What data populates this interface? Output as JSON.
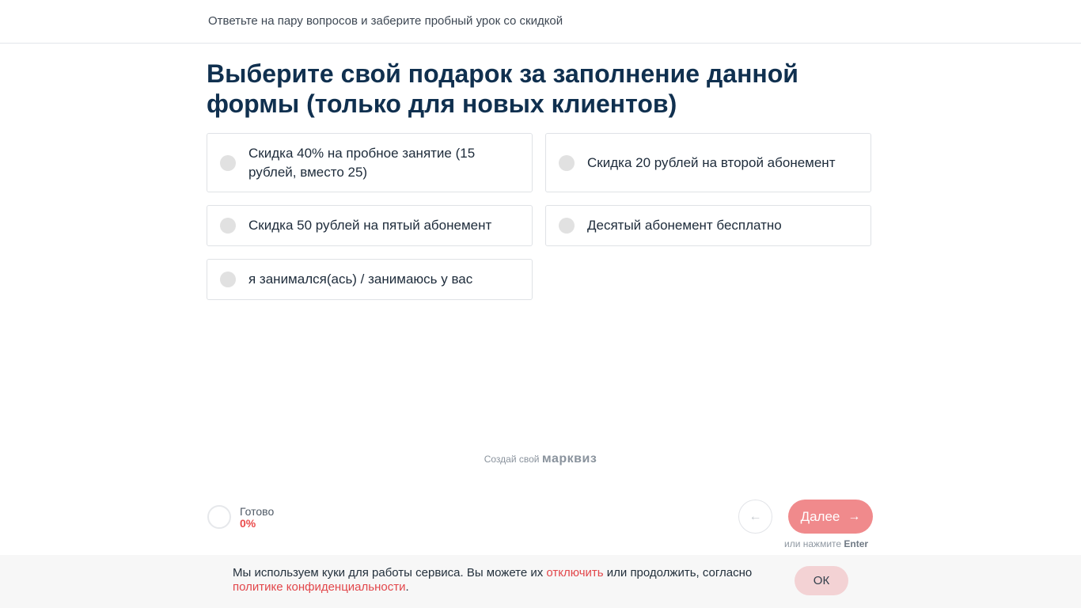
{
  "header": {
    "text": "Ответьте на пару вопросов и заберите пробный урок со скидкой"
  },
  "question": {
    "title": "Выберите свой подарок за заполнение данной формы (только для новых клиентов)"
  },
  "options": [
    {
      "label": "Скидка 40% на пробное занятие (15 рублей, вместо 25)"
    },
    {
      "label": "Скидка 20 рублей на второй абонемент"
    },
    {
      "label": "Скидка 50 рублей на пятый абонемент"
    },
    {
      "label": "Десятый абонемент бесплатно"
    },
    {
      "label": "я занимался(ась) / занимаюсь у вас"
    }
  ],
  "footer": {
    "powered_prefix": "Создай свой",
    "powered_brand": "марквиз",
    "progress_label": "Готово",
    "progress_value": "0%",
    "next_label": "Далее",
    "hint_prefix": "или нажмите",
    "hint_key": "Enter"
  },
  "cookie": {
    "text_1": "Мы используем куки для работы сервиса. Вы можете их ",
    "link_disable": "отключить",
    "text_2": " или продолжить, согласно ",
    "link_policy": "политике конфиденциальности",
    "text_3": ".",
    "ok_label": "ОК"
  },
  "colors": {
    "accent": "#ea4c4c",
    "button": "#f08a8c",
    "title": "#10304f"
  },
  "icons": {
    "back": "arrow-left-icon",
    "next": "arrow-right-icon"
  }
}
